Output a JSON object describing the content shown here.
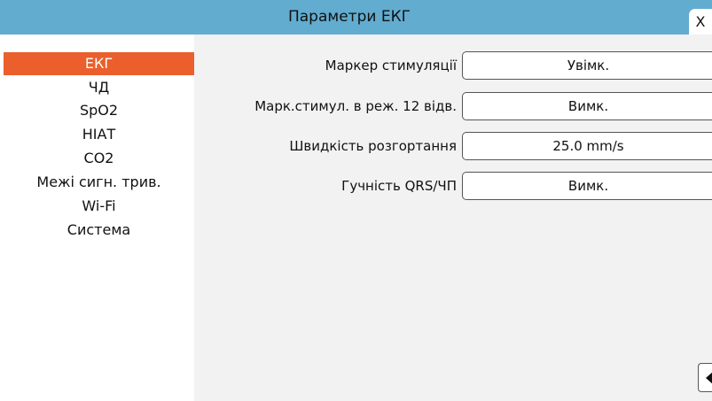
{
  "window": {
    "title": "Параметри ЕКГ",
    "close_label": "X"
  },
  "sidebar": {
    "items": [
      {
        "label": "ЕКГ",
        "active": true
      },
      {
        "label": "ЧД",
        "active": false
      },
      {
        "label": "SpO2",
        "active": false
      },
      {
        "label": "НІАТ",
        "active": false
      },
      {
        "label": "CO2",
        "active": false
      },
      {
        "label": "Межі сигн. трив.",
        "active": false
      },
      {
        "label": "Wi-Fi",
        "active": false
      },
      {
        "label": "Система",
        "active": false
      }
    ]
  },
  "settings": {
    "rows": [
      {
        "label": "Маркер стимуляції",
        "value": "Увімк."
      },
      {
        "label": "Марк.стимул. в реж. 12 відв.",
        "value": "Вимк."
      },
      {
        "label": "Швидкість розгортання",
        "value": "25.0 mm/s"
      },
      {
        "label": "Гучність QRS/ЧП",
        "value": "Вимк."
      }
    ]
  },
  "icons": {
    "close": "close-icon",
    "back": "arrow-left-icon"
  },
  "colors": {
    "titlebar": "#62acd0",
    "active_item": "#ea5f2b",
    "content_bg": "#f2f2f2"
  }
}
